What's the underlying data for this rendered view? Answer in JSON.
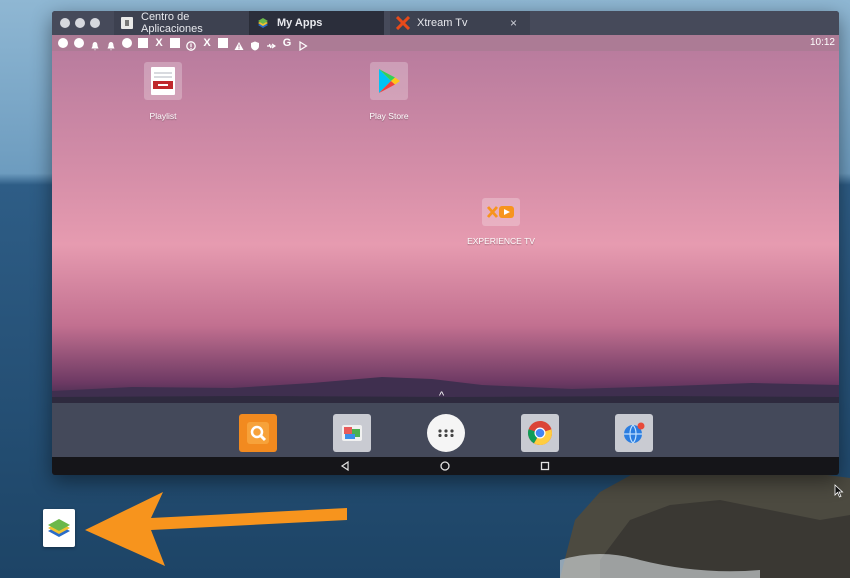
{
  "window": {
    "tabs": [
      {
        "label": "Centro de Aplicaciones",
        "icon": "app-center-icon"
      },
      {
        "label": "My Apps",
        "icon": "bluestacks-icon"
      },
      {
        "label": "Xtream Tv",
        "icon": "xtream-x-icon"
      }
    ],
    "close_glyph": "×"
  },
  "status_bar": {
    "time": "10:12",
    "glyphs": {
      "x": "X",
      "g": "G"
    }
  },
  "home": {
    "apps": [
      {
        "label": "Playlist",
        "icon": "playlist-icon"
      },
      {
        "label": "Play Store",
        "icon": "play-store-icon"
      },
      {
        "label": "EXPERIENCE TV",
        "icon": "experience-tv-icon"
      }
    ],
    "drawer_handle": "^"
  },
  "dock": {
    "items": [
      "search-app-icon",
      "gallery-app-icon",
      "app-drawer-icon",
      "chrome-icon",
      "browser-globe-icon"
    ]
  },
  "navbar": {
    "items": [
      "back-icon",
      "home-icon",
      "recents-icon"
    ]
  },
  "colors": {
    "accent_orange": "#f7941d",
    "tab_bar": "#464a5a",
    "dock": "#44495a"
  }
}
